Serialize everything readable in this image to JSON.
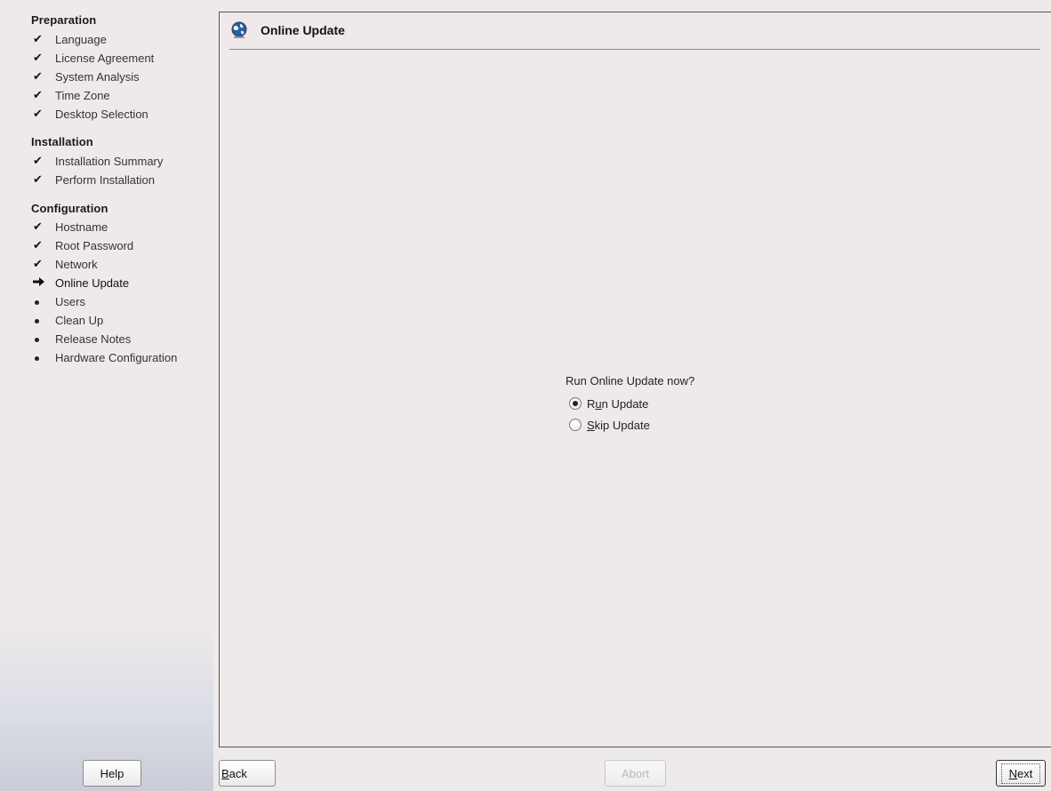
{
  "sidebar": {
    "sections": [
      {
        "title": "Preparation",
        "items": [
          {
            "label": "Language",
            "status": "done"
          },
          {
            "label": "License Agreement",
            "status": "done"
          },
          {
            "label": "System Analysis",
            "status": "done"
          },
          {
            "label": "Time Zone",
            "status": "done"
          },
          {
            "label": "Desktop Selection",
            "status": "done"
          }
        ]
      },
      {
        "title": "Installation",
        "items": [
          {
            "label": "Installation Summary",
            "status": "done"
          },
          {
            "label": "Perform Installation",
            "status": "done"
          }
        ]
      },
      {
        "title": "Configuration",
        "items": [
          {
            "label": "Hostname",
            "status": "done"
          },
          {
            "label": "Root Password",
            "status": "done"
          },
          {
            "label": "Network",
            "status": "done"
          },
          {
            "label": "Online Update",
            "status": "current"
          },
          {
            "label": "Users",
            "status": "pending"
          },
          {
            "label": "Clean Up",
            "status": "pending"
          },
          {
            "label": "Release Notes",
            "status": "pending"
          },
          {
            "label": "Hardware Configuration",
            "status": "pending"
          }
        ]
      }
    ],
    "icons": {
      "done": "checkmark-icon",
      "current": "arrow-right-icon",
      "pending": "bullet-icon"
    }
  },
  "main": {
    "title": "Online Update",
    "title_icon": "globe-icon",
    "question": "Run Online Update now?",
    "options": [
      {
        "label_pre": "R",
        "label_mnemonic": "u",
        "label_post": "n Update",
        "selected": true
      },
      {
        "label_pre": "",
        "label_mnemonic": "S",
        "label_post": "kip Update",
        "selected": false
      }
    ]
  },
  "buttons": {
    "help": "Help",
    "back_mnemonic": "B",
    "back_rest": "ack",
    "abort": "Abort",
    "next_mnemonic": "N",
    "next_rest": "ext"
  }
}
